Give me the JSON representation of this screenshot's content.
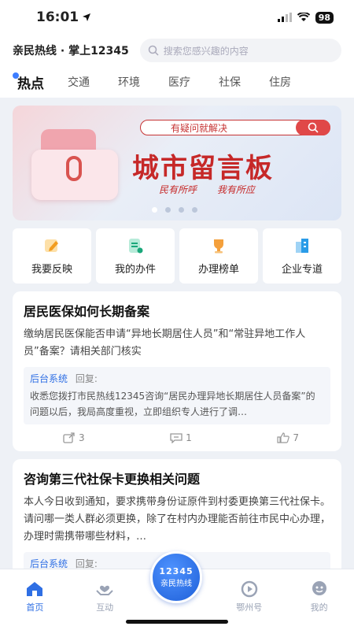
{
  "status": {
    "time": "16:01",
    "battery": "98"
  },
  "header": {
    "app_title": "亲民热线 · 掌上12345",
    "search_placeholder": "搜索您感兴趣的内容"
  },
  "tabs": [
    {
      "label": "热点"
    },
    {
      "label": "交通"
    },
    {
      "label": "环境"
    },
    {
      "label": "医疗"
    },
    {
      "label": "社保"
    },
    {
      "label": "住房"
    }
  ],
  "banner": {
    "slogan": "有疑问就解决",
    "title": "城市留言板",
    "subtitle": "民有所呼 我有所应",
    "active_slide": 1,
    "slide_count": 4
  },
  "quick_links": [
    {
      "label": "我要反映",
      "icon": "edit-icon"
    },
    {
      "label": "我的办件",
      "icon": "document-icon"
    },
    {
      "label": "办理榜单",
      "icon": "trophy-icon"
    },
    {
      "label": "企业专道",
      "icon": "building-icon"
    }
  ],
  "posts": [
    {
      "title": "居民医保如何长期备案",
      "body": "缴纳居民医保能否申请“异地长期居住人员”和“常驻异地工作人员”备案？请相关部门核实",
      "reply_source": "后台系统",
      "reply_tag": "回复:",
      "reply_text": "收悉您拨打市民热线12345咨询“居民办理异地长期居住人员备案”的问题以后，我局高度重视，立即组织专人进行了调…",
      "shares": "3",
      "comments": "1",
      "likes": "7"
    },
    {
      "title": "咨询第三代社保卡更换相关问题",
      "body": "本人今日收到通知，要求携带身份证原件到村委更换第三代社保卡。请问哪一类人群必须更换，除了在村内办理能否前往市民中心办理，办理时需携带哪些材料，…",
      "reply_source": "后台系统",
      "reply_tag": "回复:"
    }
  ],
  "tabbar": {
    "items": [
      {
        "label": "首页"
      },
      {
        "label": "互动"
      },
      {
        "label": "鄂州号"
      },
      {
        "label": "我的"
      }
    ],
    "center_number": "12345",
    "center_label": "亲民热线"
  },
  "colors": {
    "accent": "#2f6fe4",
    "banner_red": "#c62828"
  }
}
